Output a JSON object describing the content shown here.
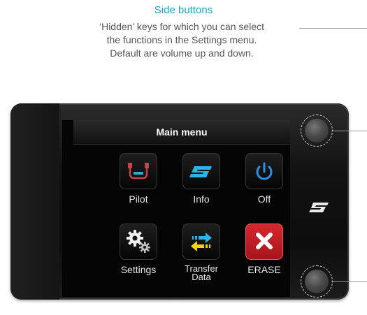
{
  "annotation": {
    "title": "Side buttons",
    "body_lines": [
      "‘Hidden’ keys for which you can select",
      "the functions in the Settings menu.",
      "Default are volume up and down."
    ]
  },
  "screen": {
    "header_title": "Main menu",
    "items": [
      {
        "label": "Pilot",
        "icon": "steering-wheel-icon"
      },
      {
        "label": "Info",
        "icon": "brand-logo-icon"
      },
      {
        "label": "Off",
        "icon": "power-icon"
      },
      {
        "label": "Settings",
        "icon": "gears-icon"
      },
      {
        "label": "Transfer",
        "label2": "Data",
        "icon": "transfer-arrows-icon"
      },
      {
        "label": "ERASE",
        "icon": "x-icon"
      }
    ]
  },
  "colors": {
    "accent": "#1aa7c6",
    "erase_red": "#c41b22",
    "arrow_yellow": "#f2d21a",
    "logo_blue": "#2bb5e6"
  }
}
